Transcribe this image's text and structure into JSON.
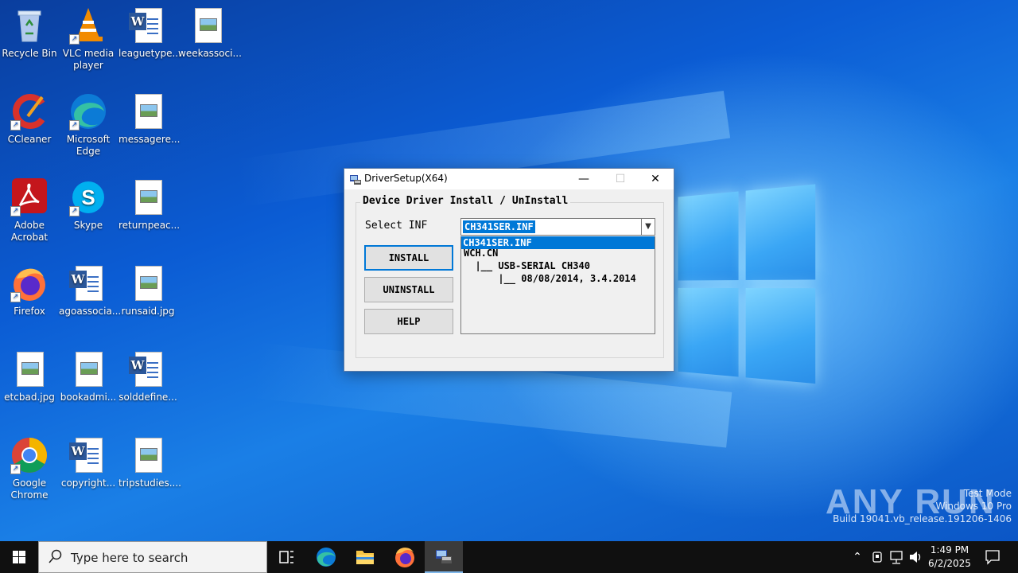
{
  "desktop": {
    "icons": [
      {
        "label": "Recycle Bin"
      },
      {
        "label": "VLC media player"
      },
      {
        "label": "leaguetype..."
      },
      {
        "label": "weekassoci..."
      },
      {
        "label": "CCleaner"
      },
      {
        "label": "Microsoft Edge"
      },
      {
        "label": "messagere..."
      },
      {
        "label": "Adobe Acrobat"
      },
      {
        "label": "Skype"
      },
      {
        "label": "returnpeac..."
      },
      {
        "label": "Firefox"
      },
      {
        "label": "agoassocia..."
      },
      {
        "label": "runsaid.jpg"
      },
      {
        "label": "etcbad.jpg"
      },
      {
        "label": "bookadmi..."
      },
      {
        "label": "solddefine..."
      },
      {
        "label": "Google Chrome"
      },
      {
        "label": "copyright..."
      },
      {
        "label": "tripstudies...."
      }
    ]
  },
  "dialog": {
    "title": "DriverSetup(X64)",
    "minimize_glyph": "—",
    "maximize_glyph": "☐",
    "close_glyph": "✕",
    "group_label": "Device Driver Install / UnInstall",
    "select_label": "Select INF",
    "combo_value": "CH341SER.INF",
    "dropdown_option": "CH341SER.INF",
    "info_lines": [
      "WCH.CN",
      "  |__ USB-SERIAL CH340",
      "      |__ 08/08/2014, 3.4.2014"
    ],
    "buttons": {
      "install": "INSTALL",
      "uninstall": "UNINSTALL",
      "help": "HELP"
    }
  },
  "watermark": {
    "brand": "ANY RUN",
    "line1": "Test Mode",
    "line2": "Windows 10 Pro",
    "line3": "Build 19041.vb_release.191206-1406"
  },
  "taskbar": {
    "search_placeholder": "Type here to search",
    "time": "1:49 PM",
    "date": "6/2/2025",
    "apps": [
      "task-view",
      "edge",
      "file-explorer",
      "firefox",
      "driversetup"
    ]
  },
  "colors": {
    "accent": "#0078d7",
    "taskbar": "#101010"
  }
}
